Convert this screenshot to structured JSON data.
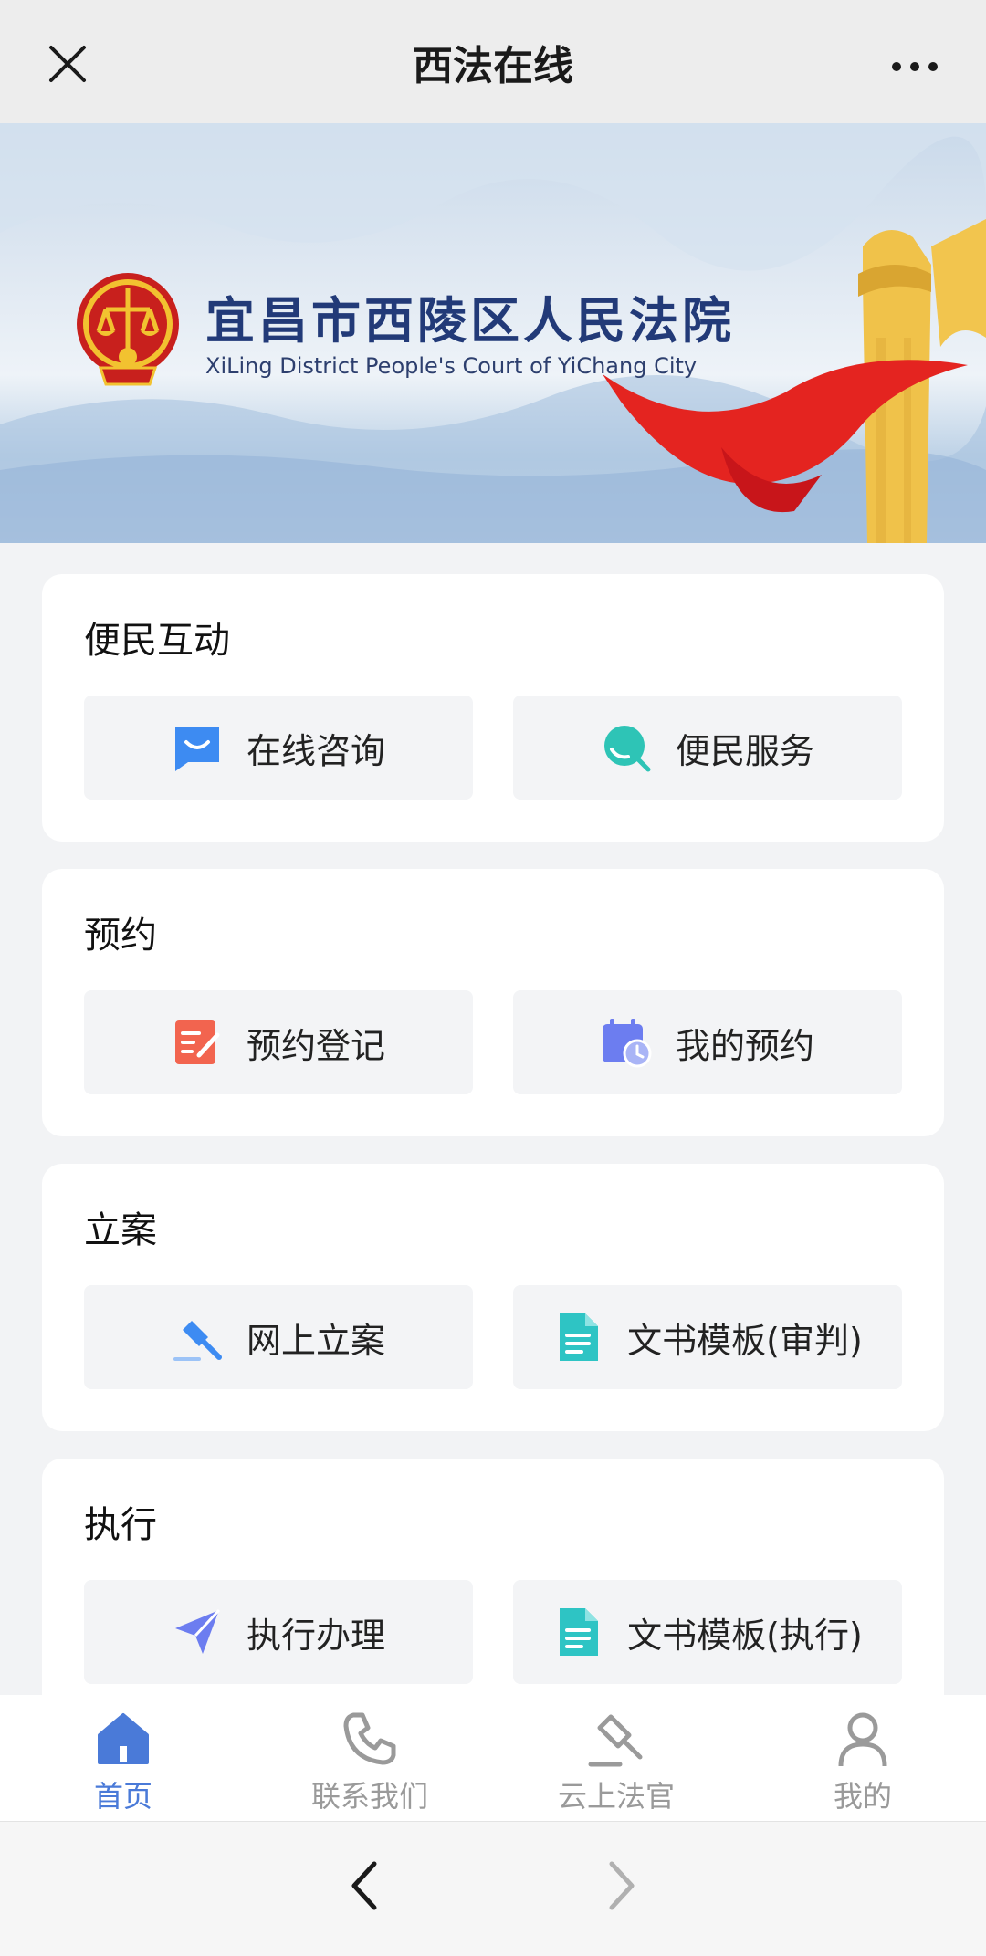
{
  "app": {
    "title": "西法在线"
  },
  "banner": {
    "court_name_cn": "宜昌市西陵区人民法院",
    "court_name_en": "XiLing District People's Court of YiChang City"
  },
  "sections": [
    {
      "title": "便民互动",
      "items": [
        {
          "label": "在线咨询",
          "icon": "chat-message-icon",
          "color": "#3d8bf2"
        },
        {
          "label": "便民服务",
          "icon": "search-bubble-icon",
          "color": "#2ec4b6"
        }
      ]
    },
    {
      "title": "预约",
      "items": [
        {
          "label": "预约登记",
          "icon": "edit-form-icon",
          "color": "#f2644f"
        },
        {
          "label": "我的预约",
          "icon": "calendar-clock-icon",
          "color": "#6c7df0"
        }
      ]
    },
    {
      "title": "立案",
      "items": [
        {
          "label": "网上立案",
          "icon": "gavel-icon",
          "color": "#3d8bf2"
        },
        {
          "label": "文书模板(审判)",
          "icon": "document-icon",
          "color": "#2ec4c4"
        }
      ]
    },
    {
      "title": "执行",
      "items": [
        {
          "label": "执行办理",
          "icon": "paper-plane-icon",
          "color": "#6c7df0"
        },
        {
          "label": "文书模板(执行)",
          "icon": "document-icon",
          "color": "#2ec4c4"
        }
      ]
    }
  ],
  "tabbar": {
    "items": [
      {
        "label": "首页",
        "icon": "home-icon",
        "active": true
      },
      {
        "label": "联系我们",
        "icon": "phone-icon",
        "active": false
      },
      {
        "label": "云上法官",
        "icon": "gavel-icon",
        "active": false
      },
      {
        "label": "我的",
        "icon": "user-icon",
        "active": false
      }
    ],
    "active_color": "#4a7ad8",
    "inactive_color": "#9a9a9a"
  }
}
